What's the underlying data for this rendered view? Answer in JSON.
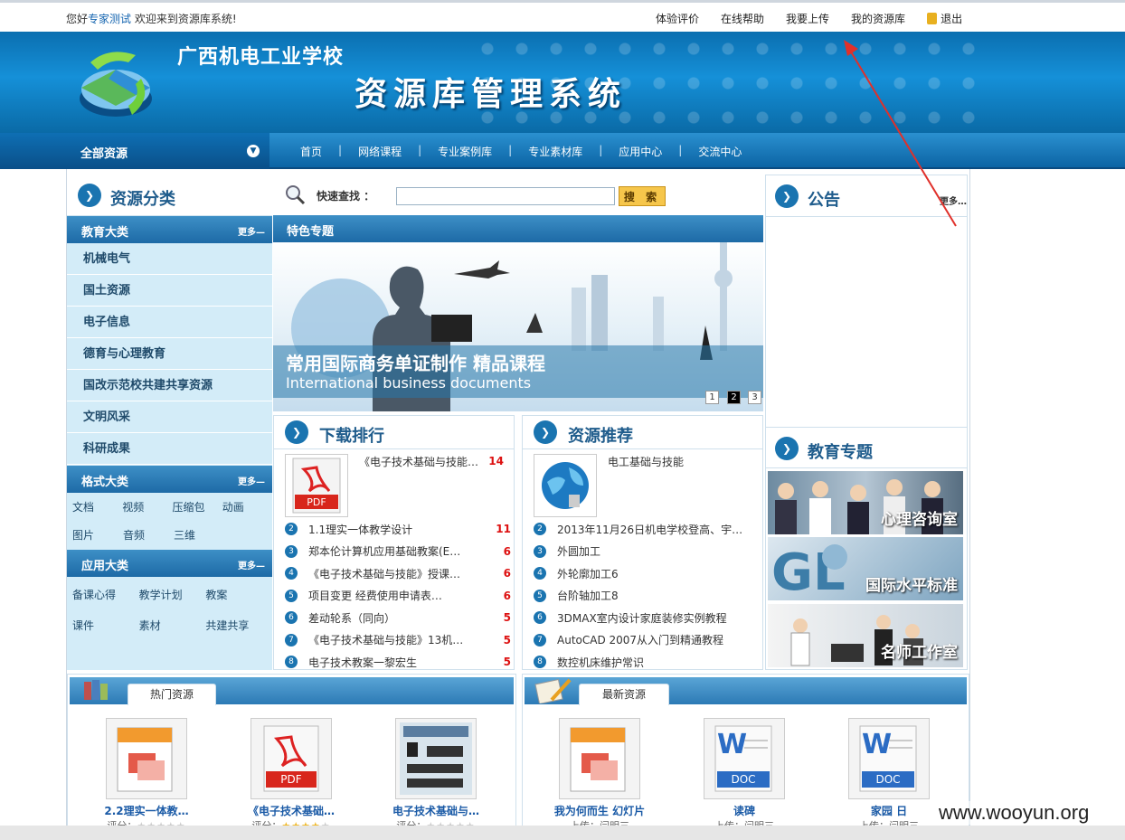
{
  "topbar": {
    "hello": "您好",
    "user": "专家测试",
    "welcome": "欢迎来到资源库系统!",
    "links": [
      "体验评价",
      "在线帮助",
      "我要上传",
      "我的资源库"
    ],
    "logout": "退出"
  },
  "banner": {
    "school": "广西机电工业学校",
    "system": "资源库管理系统"
  },
  "nav": {
    "all": "全部资源",
    "items": [
      "首页",
      "网络课程",
      "专业案例库",
      "专业素材库",
      "应用中心",
      "交流中心"
    ]
  },
  "left": {
    "title": "资源分类",
    "edu_title": "教育大类",
    "more": "更多—",
    "edu_items": [
      "机械电气",
      "国土资源",
      "电子信息",
      "德育与心理教育",
      "国改示范校共建共享资源",
      "文明风采",
      "科研成果"
    ],
    "format_title": "格式大类",
    "format_rows": [
      [
        "文档",
        "视频",
        "压缩包",
        "动画"
      ],
      [
        "图片",
        "音频",
        "三维"
      ]
    ],
    "app_title": "应用大类",
    "app_rows": [
      [
        "备课心得",
        "教学计划",
        "教案"
      ],
      [
        "课件",
        "素材",
        "共建共享"
      ]
    ]
  },
  "center": {
    "search_label": "快速查找 ：",
    "search_value": "",
    "search_button": "搜 索",
    "featured": "特色专题",
    "slide_cn": "常用国际商务单证制作 精品课程",
    "slide_en": "International business documents",
    "pages": [
      "1",
      "2",
      "3"
    ],
    "download_title": "下载排行",
    "downloads": [
      {
        "n": "1",
        "t": "《电子技术基础与技能…",
        "c": "14"
      },
      {
        "n": "2",
        "t": "1.1理实一体教学设计",
        "c": "11"
      },
      {
        "n": "3",
        "t": "郑本伦计算机应用基础教案(E…",
        "c": "6"
      },
      {
        "n": "4",
        "t": "《电子技术基础与技能》授课…",
        "c": "6"
      },
      {
        "n": "5",
        "t": "项目变更 经费使用申请表…",
        "c": "6"
      },
      {
        "n": "6",
        "t": "差动轮系（同向）",
        "c": "5"
      },
      {
        "n": "7",
        "t": "《电子技术基础与技能》13机…",
        "c": "5"
      },
      {
        "n": "8",
        "t": "电子技术教案一黎宏生",
        "c": "5"
      }
    ],
    "recommend_title": "资源推荐",
    "recommends": [
      {
        "n": "1",
        "t": "电工基础与技能"
      },
      {
        "n": "2",
        "t": "2013年11月26日机电学校登高、宇…"
      },
      {
        "n": "3",
        "t": "外圆加工"
      },
      {
        "n": "4",
        "t": "外轮廓加工6"
      },
      {
        "n": "5",
        "t": "台阶轴加工8"
      },
      {
        "n": "6",
        "t": "3DMAX室内设计家庭装修实例教程"
      },
      {
        "n": "7",
        "t": "AutoCAD 2007从入门到精通教程"
      },
      {
        "n": "8",
        "t": "数控机床维护常识"
      }
    ]
  },
  "right": {
    "notice_title": "公告",
    "more": "更多…",
    "topic_title": "教育专题",
    "topics": [
      "心理咨询室",
      "国际水平标准",
      "名师工作室"
    ]
  },
  "hot": {
    "tab": "热门资源",
    "rate_label": "评分：",
    "items": [
      {
        "name": "2.2理实一体教…",
        "icon": "slides-icon",
        "stars": 0
      },
      {
        "name": "《电子技术基础…",
        "icon": "pdf-icon",
        "stars": 4
      },
      {
        "name": "电子技术基础与…",
        "icon": "circuit-image",
        "stars": 0
      }
    ]
  },
  "latest": {
    "tab": "最新资源",
    "upload_label": "上传：闫明三",
    "items": [
      {
        "name": "我为何而生 幻灯片",
        "icon": "slides-icon"
      },
      {
        "name": "读碑",
        "icon": "word-doc-icon"
      },
      {
        "name": "家园 日",
        "icon": "word-doc-icon"
      }
    ]
  },
  "watermark": "www.wooyun.org",
  "colors": {
    "brand": "#1a74b0",
    "accent": "#f6c64b",
    "count": "#dd1111"
  }
}
